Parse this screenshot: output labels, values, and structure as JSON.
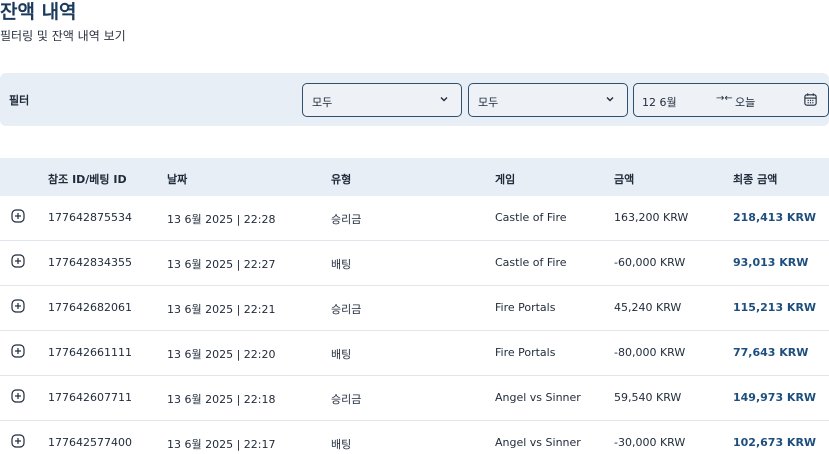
{
  "header": {
    "title": "잔액 내역",
    "subtitle": "필터링 및 잔액 내역 보기"
  },
  "filters": {
    "label": "필터",
    "type_select": "모두",
    "game_select": "모두",
    "date_from": "12 6월",
    "date_arrow": "→←",
    "date_to": "오늘"
  },
  "table": {
    "columns": [
      "참조 ID/베팅 ID",
      "날짜",
      "유형",
      "게임",
      "금액",
      "최종 금액"
    ],
    "rows": [
      [
        "177642875534",
        "13 6월 2025 | 22:28",
        "승리금",
        "Castle of Fire",
        "163,200 KRW",
        "218,413 KRW"
      ],
      [
        "177642834355",
        "13 6월 2025 | 22:27",
        "배팅",
        "Castle of Fire",
        "-60,000 KRW",
        "93,013 KRW"
      ],
      [
        "177642682061",
        "13 6월 2025 | 22:21",
        "승리금",
        "Fire Portals",
        "45,240 KRW",
        "115,213 KRW"
      ],
      [
        "177642661111",
        "13 6월 2025 | 22:20",
        "배팅",
        "Fire Portals",
        "-80,000 KRW",
        "77,643 KRW"
      ],
      [
        "177642607711",
        "13 6월 2025 | 22:18",
        "승리금",
        "Angel vs Sinner",
        "59,540 KRW",
        "149,973 KRW"
      ],
      [
        "177642577400",
        "13 6월 2025 | 22:17",
        "배팅",
        "Angel vs Sinner",
        "-30,000 KRW",
        "102,673 KRW"
      ]
    ]
  },
  "icons": {
    "expand": "plus-circle-icon",
    "dropdown": "chevron-down-icon",
    "calendar": "calendar-icon"
  },
  "colors": {
    "accent": "#1d4e7e",
    "title": "#1b3a5c",
    "filter_bg": "#e8eef5",
    "border": "#2f4f6f"
  }
}
